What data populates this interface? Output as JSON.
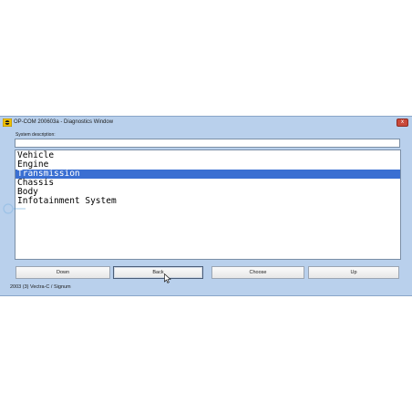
{
  "window": {
    "title": "OP-COM 200603a - Diagnostics Window",
    "close_label": "x"
  },
  "description": {
    "label": "System description:",
    "value": ""
  },
  "list": {
    "items": [
      {
        "label": "Vehicle",
        "selected": false
      },
      {
        "label": "Engine",
        "selected": false
      },
      {
        "label": "Transmission",
        "selected": true
      },
      {
        "label": "Chassis",
        "selected": false
      },
      {
        "label": "Body",
        "selected": false
      },
      {
        "label": "Infotainment System",
        "selected": false
      }
    ]
  },
  "buttons": {
    "down": "Down",
    "back": "Back",
    "choose": "Choose",
    "up": "Up"
  },
  "status": {
    "text": "2003 (3) Vectra-C / Signum"
  },
  "colors": {
    "window_bg": "#b9d0ec",
    "selection": "#3a6fd2",
    "close": "#c9493a"
  }
}
